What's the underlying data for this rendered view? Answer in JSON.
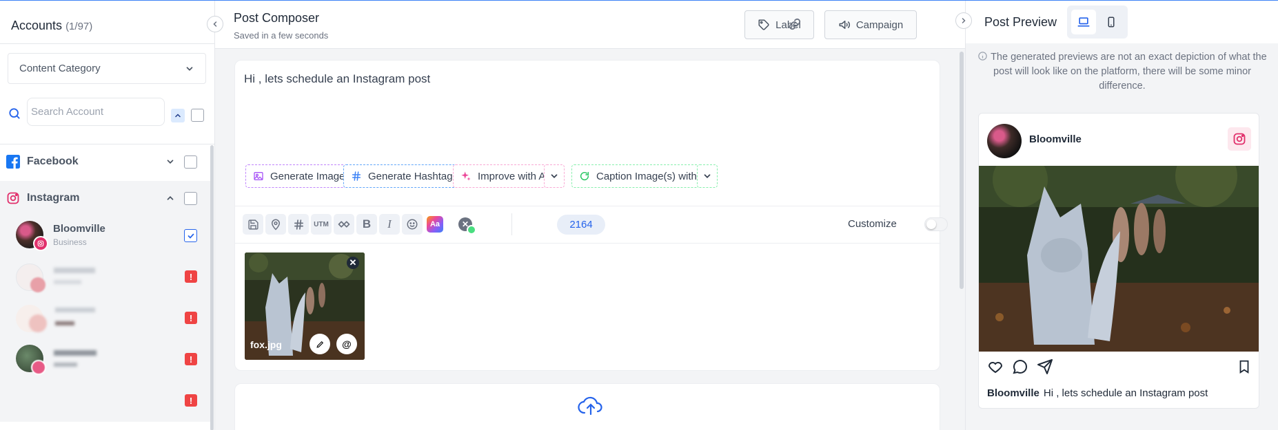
{
  "sidebar": {
    "title": "Accounts",
    "count": "(1/97)",
    "content_category": "Content Category",
    "search_placeholder": "Search Account",
    "platforms": [
      {
        "name": "Facebook"
      },
      {
        "name": "Instagram"
      }
    ],
    "accounts": [
      {
        "name": "Bloomville",
        "type": "Business",
        "checked": true
      }
    ]
  },
  "composer": {
    "title": "Post Composer",
    "saved_status": "Saved in a few seconds",
    "label_btn": "Label",
    "campaign_btn": "Campaign",
    "post_text": "Hi , lets schedule an Instagram post",
    "ai_buttons": {
      "generate_image": "Generate Image",
      "generate_hashtags": "Generate Hashtags",
      "improve_ai": "Improve with AI",
      "caption_images": "Caption Image(s) with AI"
    },
    "toolbar": {
      "utm": "UTM",
      "bold": "B",
      "italic": "I",
      "aa": "Aa",
      "char_count": "2164",
      "customize": "Customize"
    },
    "media": {
      "filename": "fox.jpg"
    }
  },
  "preview": {
    "title": "Post Preview",
    "note": "The generated previews are not an exact depiction of what the post will look like on the platform, there will be some minor difference.",
    "account_name": "Bloomville",
    "caption_name": "Bloomville",
    "caption_text": "Hi , lets schedule an Instagram post"
  },
  "colors": {
    "accent": "#2563eb",
    "facebook": "#1877f2",
    "instagram": "#e1306c",
    "warning": "#ef4444"
  },
  "icons": [
    "search-icon",
    "chevron-down-icon",
    "chevron-up-icon",
    "facebook-icon",
    "instagram-icon",
    "tag-icon",
    "megaphone-icon",
    "link-icon",
    "laptop-icon",
    "mobile-icon",
    "info-icon",
    "heart-icon",
    "comment-icon",
    "send-icon",
    "bookmark-icon",
    "upload-cloud-icon"
  ]
}
